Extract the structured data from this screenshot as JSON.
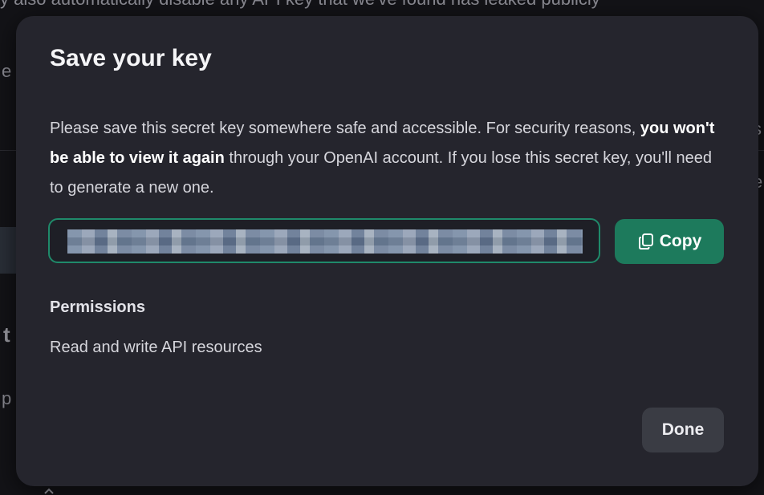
{
  "background": {
    "top_text": "y also automatically disable any API key that we've found has leaked publicly",
    "left_fragments": [
      "e",
      "k",
      "t",
      "p"
    ],
    "right_fragments": [
      "s",
      "e",
      "t"
    ]
  },
  "modal": {
    "title": "Save your key",
    "description": {
      "before_bold": "Please save this secret key somewhere safe and accessible. For security reasons, ",
      "bold": "you won't be able to view it again",
      "after_bold": " through your OpenAI account. If you lose this secret key, you'll need to generate a new one."
    },
    "key_field": {
      "value": "",
      "state": "obscured"
    },
    "copy_button": {
      "label": "Copy",
      "icon": "copy-icon"
    },
    "permissions": {
      "heading": "Permissions",
      "value": "Read and write API resources"
    },
    "done_button": {
      "label": "Done"
    }
  },
  "colors": {
    "accent": "#1d7a5c",
    "field_border": "#1f8a6a",
    "modal_bg": "#25252d"
  }
}
